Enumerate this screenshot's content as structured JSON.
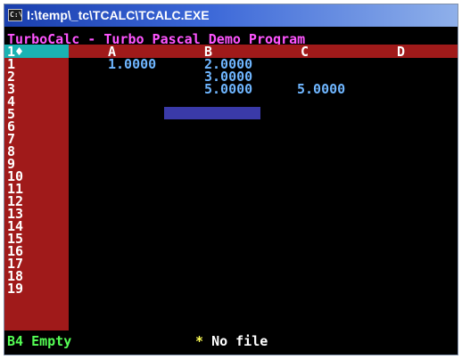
{
  "window": {
    "title": "I:\\temp\\_tc\\TCALC\\TCALC.EXE",
    "icon": "command-prompt-icon",
    "icon_glyph": "C:\\"
  },
  "program_title": "TurboCalc - Turbo Pascal Demo Program",
  "grid": {
    "corner": "1♦",
    "columns": [
      "A",
      "B",
      "C",
      "D"
    ],
    "rows": [
      "1",
      "2",
      "3",
      "4",
      "5",
      "6",
      "7",
      "8",
      "9",
      "10",
      "11",
      "12",
      "13",
      "14",
      "15",
      "16",
      "17",
      "18",
      "19"
    ],
    "cells": {
      "A1": "1.0000",
      "B1": "2.0000",
      "B2": "3.0000",
      "B3": "5.0000",
      "C3": "5.0000"
    },
    "selected_cell": "B4"
  },
  "status": {
    "cell_info": "B4 Empty",
    "file_marker": "*",
    "file_text": "No file"
  },
  "colors": {
    "title_bar": "#1a3fae",
    "program_title": "#ff55ff",
    "header_bar": "#a01a1a",
    "corner_cell": "#1ab3b3",
    "cell_values": "#6fb6ff",
    "cursor": "#3a3aa8",
    "status_cell": "#55ff55",
    "status_star": "#ffff55"
  }
}
